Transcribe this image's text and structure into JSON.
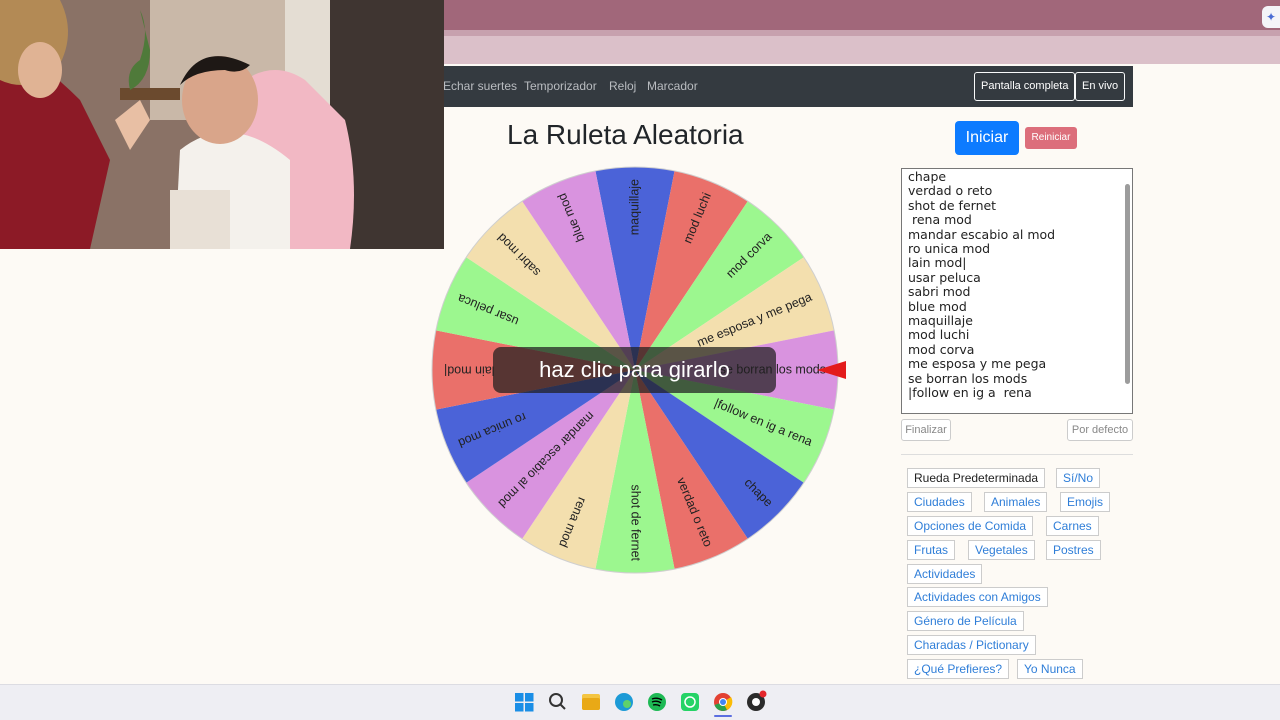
{
  "nav": {
    "links": [
      "Echar suertes",
      "Temporizador",
      "Reloj",
      "Marcador"
    ],
    "fullscreen": "Pantalla completa",
    "live": "En vivo"
  },
  "page": {
    "title": "La Ruleta Aleatoria",
    "start": "Iniciar",
    "reset": "Reiniciar",
    "overlay": "haz clic para girarlo"
  },
  "wheel": {
    "segments": [
      {
        "label": "maquillaje",
        "color": "#4b63d8"
      },
      {
        "label": "mod luchi",
        "color": "#ea706a"
      },
      {
        "label": "mod corva",
        "color": "#9cf78f"
      },
      {
        "label": "me esposa y me pega",
        "color": "#f3dfae"
      },
      {
        "label": "se borran los mods",
        "color": "#d993df"
      },
      {
        "label": "|follow en ig a  rena",
        "color": "#9cf78f"
      },
      {
        "label": "chape",
        "color": "#4b63d8"
      },
      {
        "label": "verdad o reto",
        "color": "#ea706a"
      },
      {
        "label": "shot de fernet",
        "color": "#9cf78f"
      },
      {
        "label": " rena mod",
        "color": "#f3dfae"
      },
      {
        "label": "mandar escabio al mod",
        "color": "#d993df"
      },
      {
        "label": "ro unica mod",
        "color": "#4b63d8"
      },
      {
        "label": "lain mod|",
        "color": "#ea706a"
      },
      {
        "label": "usar peluca",
        "color": "#9cf78f"
      },
      {
        "label": "sabri mod",
        "color": "#f3dfae"
      },
      {
        "label": "blue mod",
        "color": "#d993df"
      }
    ],
    "pointer_color": "#e31b1b"
  },
  "entries_text": "chape\nverdad o reto\nshot de fernet\n rena mod\nmandar escabio al mod\nro unica mod\nlain mod|\nusar peluca\nsabri mod\nblue mod\nmaquillaje\nmod luchi\nmod corva\nme esposa y me pega\nse borran los mods\n|follow en ig a  rena",
  "actions": {
    "finalize": "Finalizar",
    "default": "Por defecto"
  },
  "presets": [
    "Rueda Predeterminada",
    "Sí/No",
    "Ciudades",
    "Animales",
    "Emojis",
    "Opciones de Comida",
    "Carnes",
    "Frutas",
    "Vegetales",
    "Postres",
    "Actividades",
    "Actividades con Amigos",
    "Género de Película",
    "Charadas / Pictionary",
    "¿Qué Prefieres?",
    "Yo Nunca"
  ],
  "taskbar": {
    "icons": [
      "windows-start-icon",
      "search-icon",
      "file-explorer-icon",
      "edge-icon",
      "spotify-icon",
      "whatsapp-icon",
      "chrome-icon",
      "obs-icon"
    ]
  }
}
